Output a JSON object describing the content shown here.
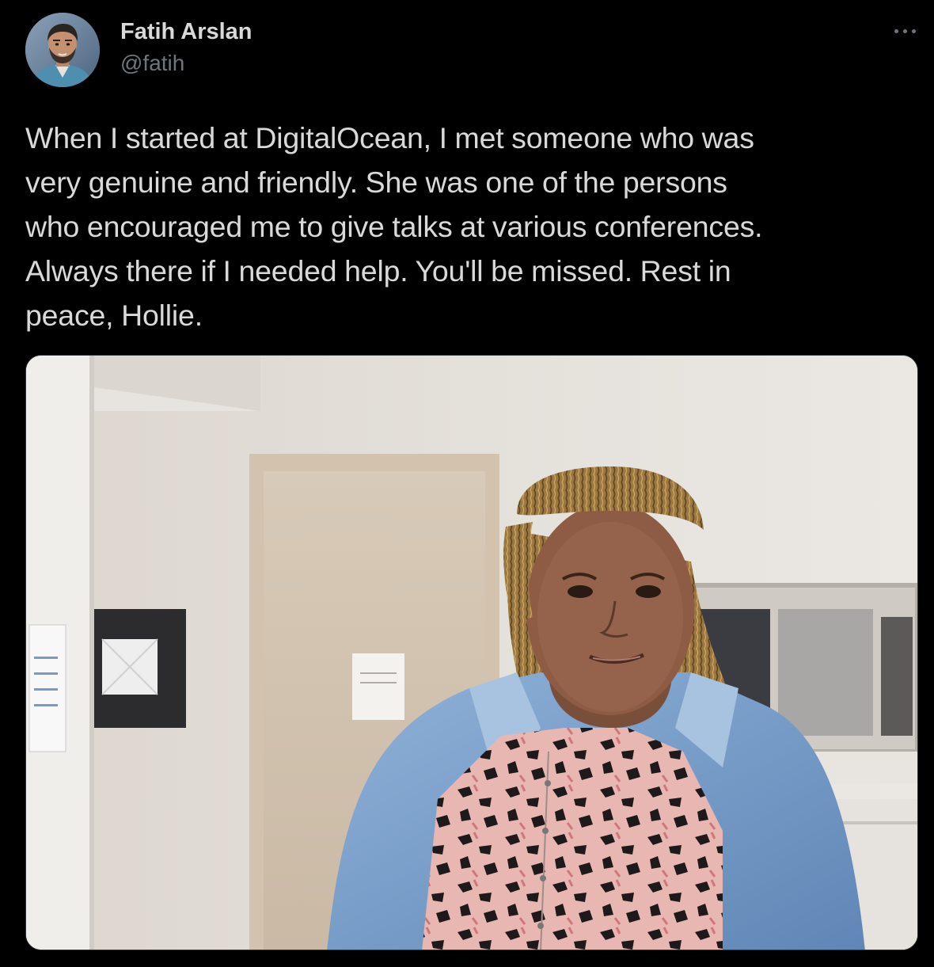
{
  "author": {
    "display_name": "Fatih Arslan",
    "handle": "@fatih",
    "avatar_icon": "user-avatar-photo"
  },
  "menu": {
    "icon": "more-options-icon"
  },
  "tweet": {
    "lines": [
      "When I started at DigitalOcean, I met someone who was",
      "very genuine and friendly. She was one of the persons",
      "who encouraged me to give talks at various conferences.",
      "Always there if I needed help. You'll be missed. Rest in",
      "peace, Hollie."
    ]
  },
  "media": {
    "kind": "photo"
  },
  "colors": {
    "background": "#000000",
    "primary_text": "#d9d9d9",
    "secondary_text": "#6e767d",
    "border": "#2f3336"
  }
}
